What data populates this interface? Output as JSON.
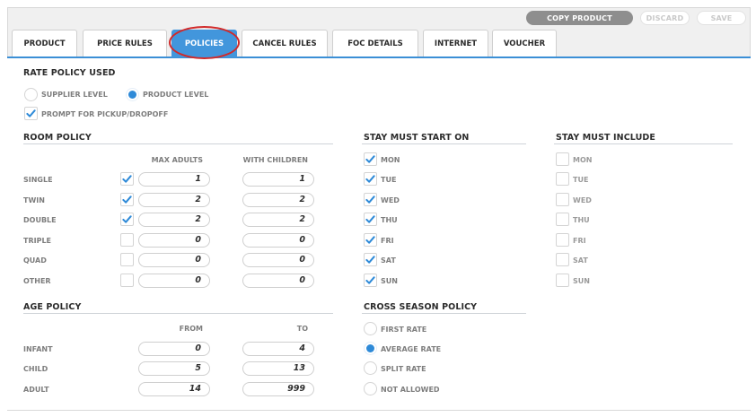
{
  "toolbar": {
    "copy_label": "COPY PRODUCT",
    "discard_label": "DISCARD",
    "save_label": "SAVE"
  },
  "tabs": [
    {
      "label": "PRODUCT",
      "active": false
    },
    {
      "label": "PRICE RULES",
      "active": false
    },
    {
      "label": "POLICIES",
      "active": true
    },
    {
      "label": "CANCEL RULES",
      "active": false
    },
    {
      "label": "FOC DETAILS",
      "active": false
    },
    {
      "label": "INTERNET",
      "active": false
    },
    {
      "label": "VOUCHER",
      "active": false
    }
  ],
  "rate_policy": {
    "title": "RATE POLICY USED",
    "options": [
      {
        "label": "SUPPLIER LEVEL",
        "selected": false
      },
      {
        "label": "PRODUCT LEVEL",
        "selected": true
      }
    ],
    "prompt": {
      "label": "PROMPT FOR PICKUP/DROPOFF",
      "checked": true
    }
  },
  "room_policy": {
    "title": "ROOM POLICY",
    "col_max_adults": "MAX ADULTS",
    "col_with_children": "WITH CHILDREN",
    "rows": [
      {
        "label": "SINGLE",
        "checked": true,
        "max_adults": "1",
        "with_children": "1"
      },
      {
        "label": "TWIN",
        "checked": true,
        "max_adults": "2",
        "with_children": "2"
      },
      {
        "label": "DOUBLE",
        "checked": true,
        "max_adults": "2",
        "with_children": "2"
      },
      {
        "label": "TRIPLE",
        "checked": false,
        "max_adults": "0",
        "with_children": "0"
      },
      {
        "label": "QUAD",
        "checked": false,
        "max_adults": "0",
        "with_children": "0"
      },
      {
        "label": "OTHER",
        "checked": false,
        "max_adults": "0",
        "with_children": "0"
      }
    ]
  },
  "age_policy": {
    "title": "AGE POLICY",
    "col_from": "FROM",
    "col_to": "TO",
    "rows": [
      {
        "label": "INFANT",
        "from": "0",
        "to": "4"
      },
      {
        "label": "CHILD",
        "from": "5",
        "to": "13"
      },
      {
        "label": "ADULT",
        "from": "14",
        "to": "999"
      }
    ]
  },
  "stay_must_start_on": {
    "title": "STAY MUST START ON",
    "days": [
      {
        "label": "MON",
        "checked": true
      },
      {
        "label": "TUE",
        "checked": true
      },
      {
        "label": "WED",
        "checked": true
      },
      {
        "label": "THU",
        "checked": true
      },
      {
        "label": "FRI",
        "checked": true
      },
      {
        "label": "SAT",
        "checked": true
      },
      {
        "label": "SUN",
        "checked": true
      }
    ]
  },
  "stay_must_include": {
    "title": "STAY MUST INCLUDE",
    "days": [
      {
        "label": "MON",
        "checked": false
      },
      {
        "label": "TUE",
        "checked": false
      },
      {
        "label": "WED",
        "checked": false
      },
      {
        "label": "THU",
        "checked": false
      },
      {
        "label": "FRI",
        "checked": false
      },
      {
        "label": "SAT",
        "checked": false
      },
      {
        "label": "SUN",
        "checked": false
      }
    ]
  },
  "cross_season_policy": {
    "title": "CROSS SEASON POLICY",
    "options": [
      {
        "label": "FIRST RATE",
        "selected": false
      },
      {
        "label": "AVERAGE RATE",
        "selected": true
      },
      {
        "label": "SPLIT RATE",
        "selected": false
      },
      {
        "label": "NOT ALLOWED",
        "selected": false
      }
    ]
  },
  "colors": {
    "accent": "#4296dc",
    "check": "#2e8ad8",
    "highlight_ring": "#d12a2a",
    "copy_button": "#8e8e8e"
  }
}
